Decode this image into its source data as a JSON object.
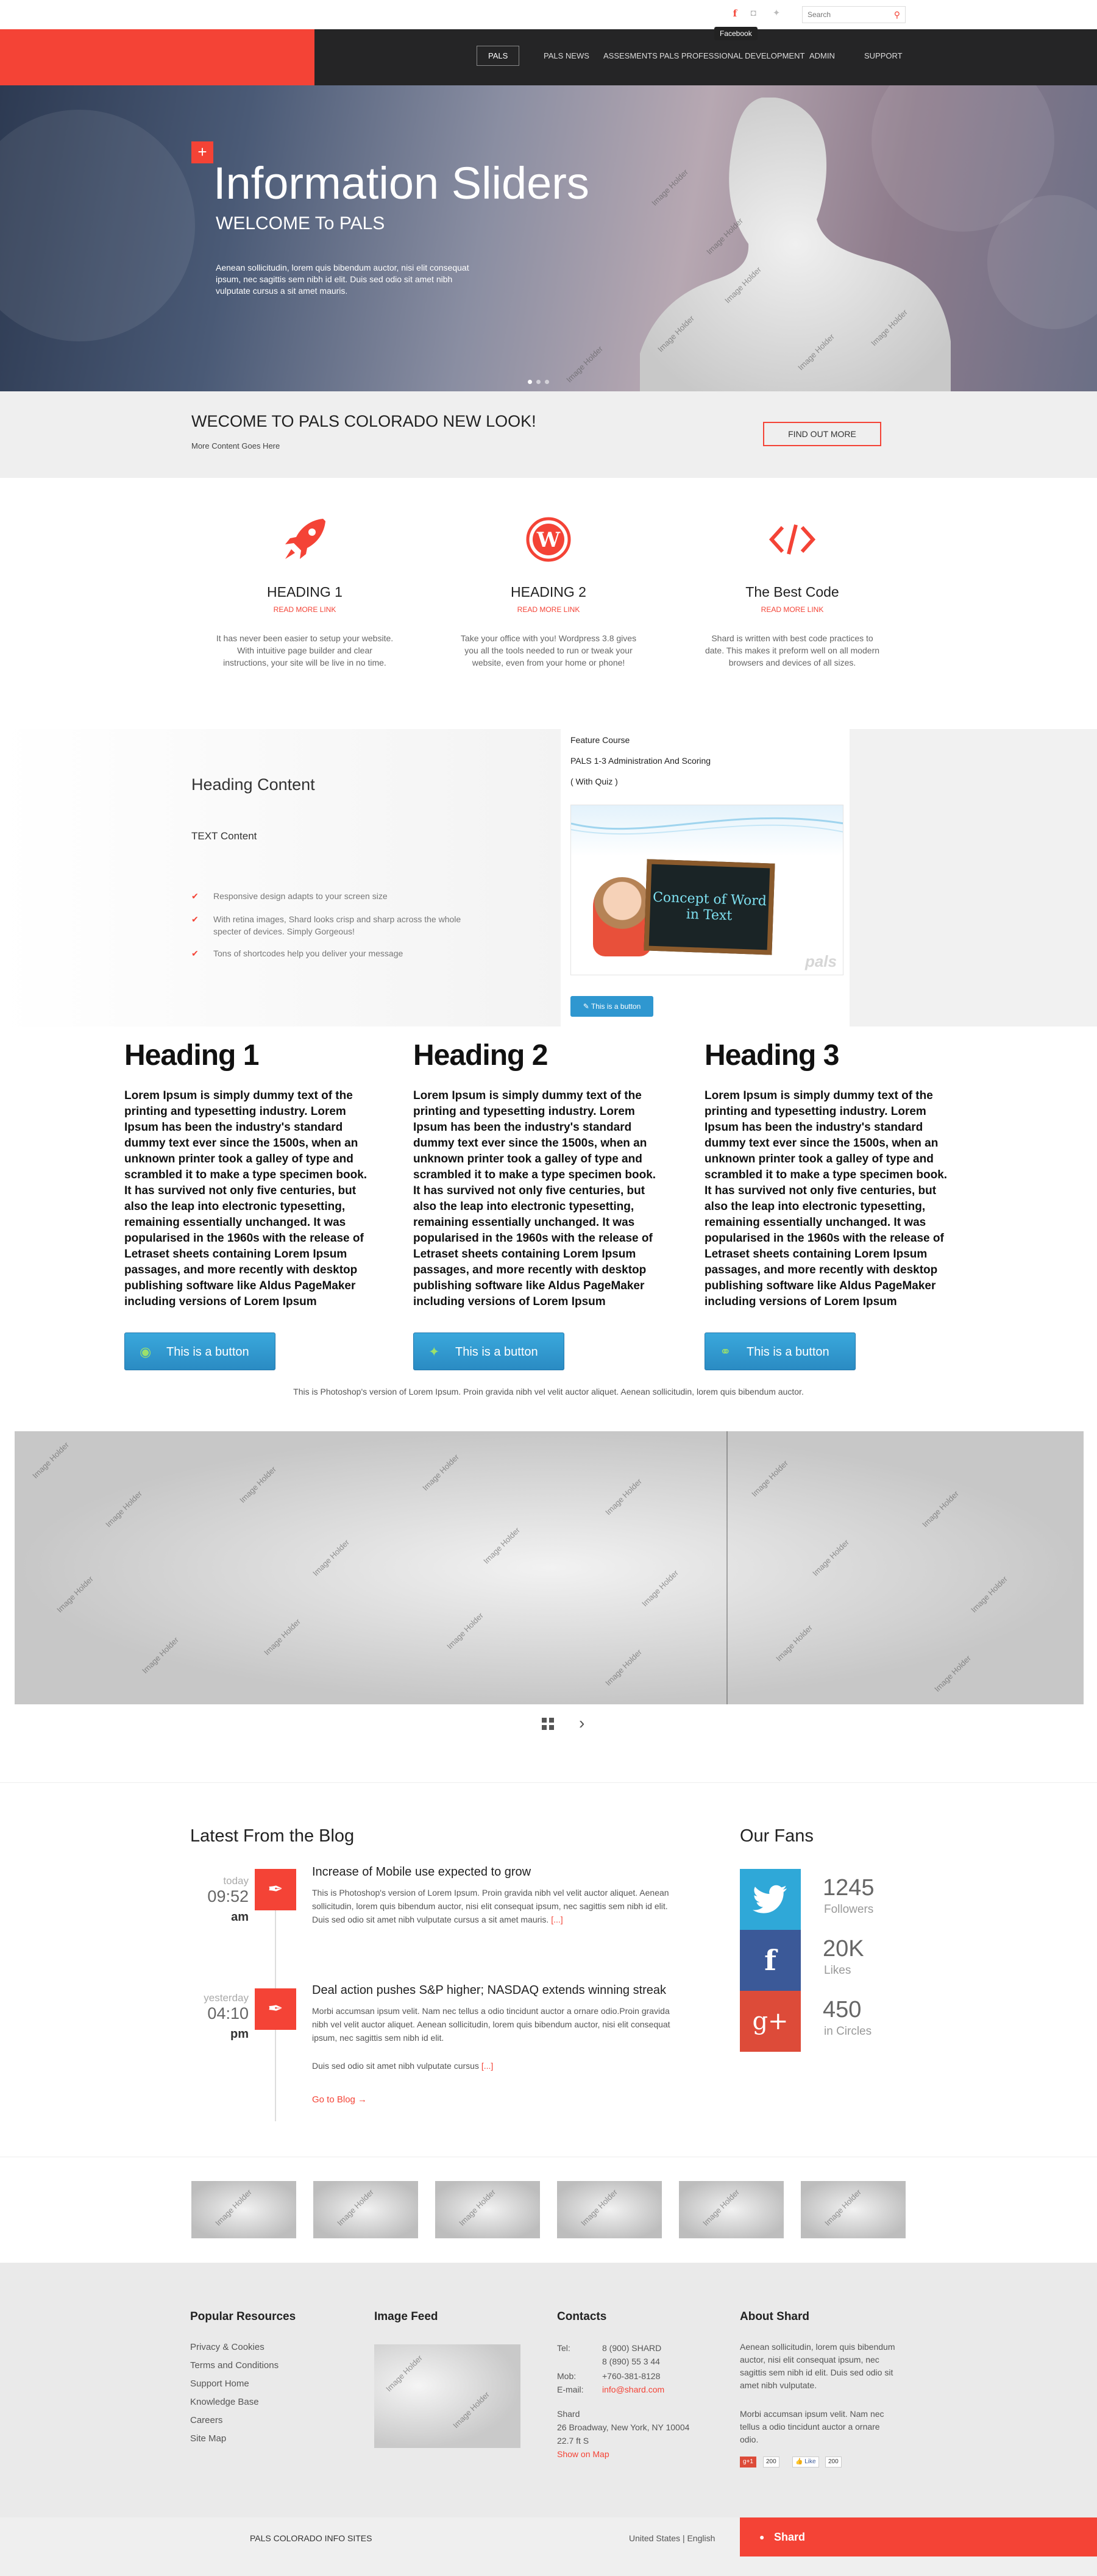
{
  "topbar": {
    "social": [
      {
        "name": "facebook",
        "glyph": "f",
        "color": "#f44336"
      },
      {
        "name": "instagram",
        "glyph": "◘",
        "color": "#bbbbbb"
      },
      {
        "name": "twitter",
        "glyph": "✦",
        "color": "#bbbbbb"
      }
    ],
    "tooltip": "Facebook",
    "search_placeholder": "Search"
  },
  "nav": {
    "items": [
      "PALS",
      "PALS NEWS",
      "ASSESMENTS",
      "PALS PROFESSIONAL DEVELOPMENT",
      "ADMIN",
      "SUPPORT"
    ]
  },
  "hero": {
    "plus": "+",
    "title": "Information Sliders",
    "subtitle": "WELCOME To PALS",
    "text": "Aenean sollicitudin, lorem quis bibendum auctor, nisi elit consequat ipsum, nec sagittis sem nibh id elit. Duis sed odio sit amet nibh vulputate cursus a sit amet mauris.",
    "placeholder_label": "Image Holder"
  },
  "welcome": {
    "title": "WECOME TO PALS COLORADO NEW LOOK!",
    "subtitle": "More Content Goes Here",
    "button": "FIND OUT MORE"
  },
  "features": [
    {
      "icon": "rocket-icon",
      "heading": "HEADING 1",
      "link": "READ MORE LINK",
      "text": "It has never been easier to setup your website. With intuitive page builder and clear instructions, your site will be live in no time."
    },
    {
      "icon": "wordpress-icon",
      "heading": "HEADING 2",
      "link": "READ MORE LINK",
      "text": "Take your office with you! Wordpress 3.8 gives you all the tools needed to run or tweak your website, even from your home or phone!"
    },
    {
      "icon": "code-icon",
      "heading": "The Best Code",
      "link": "READ MORE LINK",
      "text": "Shard is written with best code practices to date. This makes it preform well on all modern browsers and devices of all sizes."
    }
  ],
  "content_band": {
    "heading": "Heading Content",
    "text_content": "TEXT Content",
    "checks": [
      "Responsive design adapts to your screen size",
      "With retina images, Shard looks crisp and sharp across the whole specter of devices. Simply Gorgeous!",
      "Tons of shortcodes help you deliver your message"
    ],
    "feature": {
      "label": "Feature Course",
      "course": "PALS 1-3 Administration And Scoring",
      "quiz": "( With Quiz )",
      "board_text": "Concept of Word in Text",
      "watermark": "pals",
      "button": "This is a button"
    }
  },
  "columns": [
    {
      "heading": "Heading 1",
      "text": "Lorem Ipsum is simply dummy text of the printing and typesetting industry. Lorem Ipsum has been the industry's standard dummy text ever since the 1500s, when an unknown printer took a galley of type and scrambled it to make a type specimen book. It has survived not only five centuries, but also the leap into electronic typesetting, remaining essentially unchanged. It was popularised in the 1960s with the release of Letraset sheets containing Lorem Ipsum passages, and more recently with desktop publishing software like Aldus PageMaker including versions of Lorem Ipsum",
      "button": "This is a button",
      "icon": "camera-icon"
    },
    {
      "heading": "Heading 2",
      "text": "Lorem Ipsum is simply dummy text of the printing and typesetting industry. Lorem Ipsum has been the industry's standard dummy text ever since the 1500s, when an unknown printer took a galley of type and scrambled it to make a type specimen book. It has survived not only five centuries, but also the leap into electronic typesetting, remaining essentially unchanged. It was popularised in the 1960s with the release of Letraset sheets containing Lorem Ipsum passages, and more recently with desktop publishing software like Aldus PageMaker including versions of Lorem Ipsum",
      "button": "This is a button",
      "icon": "twitter-icon"
    },
    {
      "heading": "Heading 3",
      "text": "Lorem Ipsum is simply dummy text of the printing and typesetting industry. Lorem Ipsum has been the industry's standard dummy text ever since the 1500s, when an unknown printer took a galley of type and scrambled it to make a type specimen book. It has survived not only five centuries, but also the leap into electronic typesetting, remaining essentially unchanged. It was popularised in the 1960s with the release of Letraset sheets containing Lorem Ipsum passages, and more recently with desktop publishing software like Aldus PageMaker including versions of Lorem Ipsum",
      "button": "This is a button",
      "icon": "microphone-icon"
    }
  ],
  "photoshop_text": "This is Photoshop's version  of Lorem Ipsum. Proin gravida nibh vel velit auctor aliquet. Aenean sollicitudin, lorem quis bibendum auctor.",
  "gallery": {
    "placeholder_label": "Image Holder"
  },
  "blog": {
    "title": "Latest From the Blog",
    "posts": [
      {
        "day": "today",
        "time": "09:52",
        "ampm": "am",
        "title": "Increase of Mobile use expected to grow",
        "text": "This is Photoshop's version  of Lorem Ipsum. Proin gravida nibh vel velit auctor aliquet. Aenean sollicitudin, lorem quis bibendum auctor, nisi elit consequat ipsum, nec sagittis sem nibh id elit. Duis sed odio sit amet nibh vulputate cursus a sit amet mauris.",
        "more": "[...]"
      },
      {
        "day": "yesterday",
        "time": "04:10",
        "ampm": "pm",
        "title": "Deal action pushes S&P higher; NASDAQ extends winning streak",
        "text": "Morbi accumsan ipsum velit. Nam nec tellus a odio tincidunt auctor a ornare odio.Proin gravida nibh vel velit auctor aliquet. Aenean sollicitudin, lorem quis bibendum auctor, nisi elit consequat ipsum, nec sagittis sem nibh id elit.",
        "text2": "Duis sed odio sit amet nibh vulputate cursus",
        "more": "[...]"
      }
    ],
    "go_to_blog": "Go to Blog →"
  },
  "fans": {
    "title": "Our Fans",
    "items": [
      {
        "network": "twitter",
        "glyph": "🐦",
        "count": "1245",
        "label": "Followers",
        "color": "#2fa8d8"
      },
      {
        "network": "facebook",
        "glyph": "f",
        "count": "20K",
        "label": "Likes",
        "color": "#3b5998"
      },
      {
        "network": "google-plus",
        "glyph": "g+",
        "count": "450",
        "label": "in Circles",
        "color": "#dd4b39"
      }
    ]
  },
  "footer": {
    "popular_title": "Popular Resources",
    "popular_links": [
      "Privacy & Cookies",
      "Terms and Conditions",
      "Support Home",
      "Knowledge Base",
      "Careers",
      "Site Map"
    ],
    "image_feed_title": "Image Feed",
    "contacts_title": "Contacts",
    "contacts": {
      "tel_label": "Tel:",
      "tel1": "8 (900) SHARD",
      "tel2": "8 (890) 55 3 44",
      "mob_label": "Mob:",
      "mob": "+760-381-8128",
      "email_label": "E-mail:",
      "email": "info@shard.com",
      "addr1": "Shard",
      "addr2": "26 Broadway, New York, NY 10004",
      "addr3": "22.7 ft S",
      "map_link": "Show on Map"
    },
    "about_title": "About Shard",
    "about_p1": "Aenean sollicitudin, lorem quis bibendum auctor, nisi elit consequat ipsum, nec sagittis sem nibh id elit. Duis sed odio sit amet nibh vulputate.",
    "about_p2": "Morbi accumsan ipsum velit. Nam nec tellus a odio tincidunt auctor a ornare odio.",
    "gplus_label": "g+1",
    "gplus_count": "200",
    "fb_label": "👍 Like",
    "fb_count": "200"
  },
  "bottombar": {
    "left": "PALS COLORADO INFO SITES",
    "lang": "United States | English",
    "brand": "Shard"
  }
}
